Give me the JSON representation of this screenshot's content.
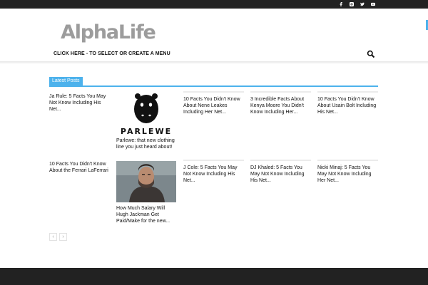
{
  "site": {
    "logo_text": "AlphaLife"
  },
  "header": {
    "menu_hint": "CLICK HERE - TO SELECT OR CREATE A MENU",
    "social_icons": [
      "facebook-icon",
      "instagram-icon",
      "twitter-icon",
      "youtube-icon"
    ]
  },
  "block": {
    "title": "Latest Posts"
  },
  "posts": [
    {
      "title": "Ja Rule: 5 Facts You May Not Know Including His Net..."
    },
    {
      "title": "Parlewe: that new clothing line you just heard about!",
      "image_text": "PARLEWE"
    },
    {
      "title": "10 Facts You Didn't Know About Nene Leakes Including Her Net..."
    },
    {
      "title": "3 Incredible Facts About Kenya Moore You Didn't Know Including Her..."
    },
    {
      "title": "10 Facts You Didn't Know About Usain Bolt Including His Net..."
    },
    {
      "title": "10 Facts You Didn't Know About the Ferrari LaFerrari"
    },
    {
      "title": "How Much Salary Will Hugh Jackman Get Paid/Make for the new..."
    },
    {
      "title": "J Cole: 5 Facts You May Not Know Including His Net..."
    },
    {
      "title": "DJ Khaled: 5 Facts You May Not Know Including His Net..."
    },
    {
      "title": "Nicki Minaj: 5 Facts You May Not Know Including Her Net..."
    }
  ],
  "pagination": {
    "prev": "‹",
    "next": "›"
  },
  "colors": {
    "accent": "#4db2ec",
    "topbar": "#222222",
    "logo": "#9c9c9c"
  }
}
